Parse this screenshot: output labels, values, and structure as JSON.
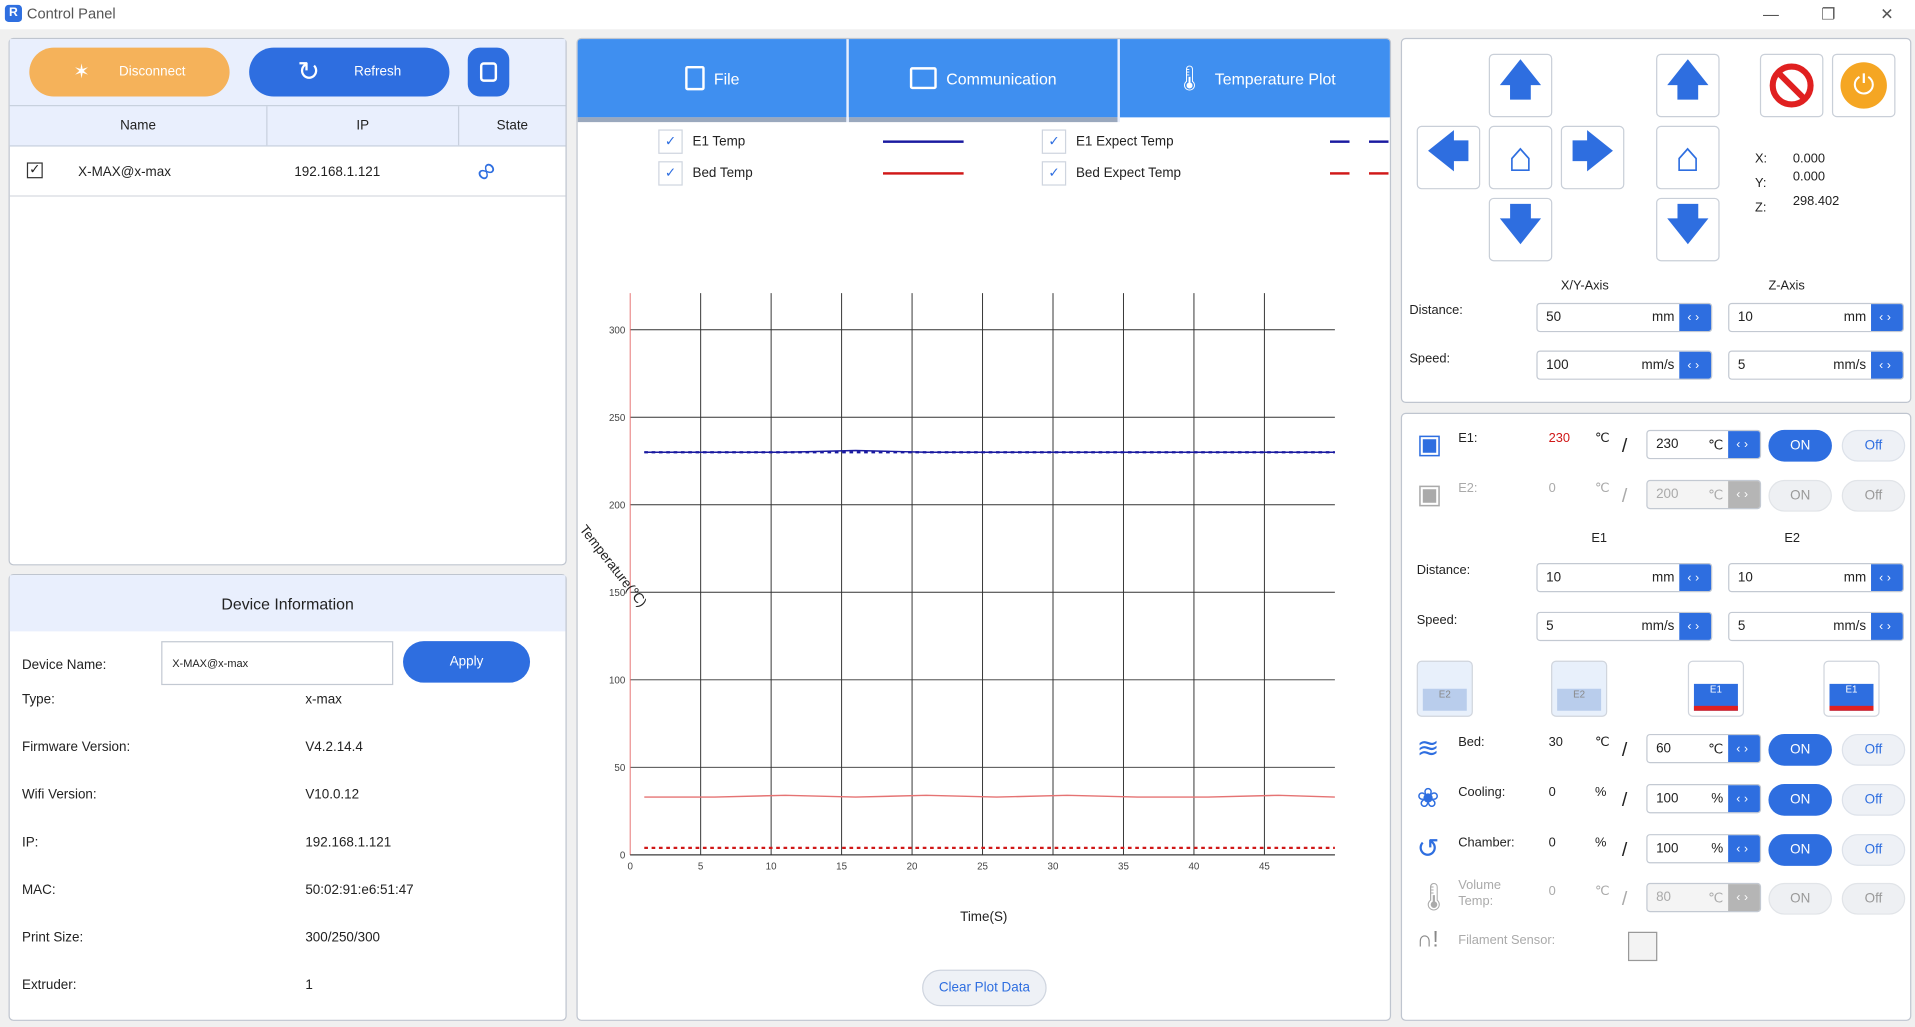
{
  "window": {
    "title": "Control Panel",
    "app_icon": "app-logo-icon"
  },
  "connection": {
    "disconnect_label": "Disconnect",
    "refresh_label": "Refresh",
    "columns": [
      "Name",
      "IP",
      "State"
    ],
    "rows": [
      {
        "checked": true,
        "name": "X-MAX@x-max",
        "ip": "192.168.1.121",
        "state_icon": "link-icon"
      }
    ]
  },
  "device_info": {
    "title": "Device Information",
    "name_label": "Device Name:",
    "name_value": "X-MAX@x-max",
    "apply_label": "Apply",
    "fields": [
      {
        "label": "Type:",
        "value": "x-max"
      },
      {
        "label": "Firmware Version:",
        "value": "V4.2.14.4"
      },
      {
        "label": "Wifi Version:",
        "value": "V10.0.12"
      },
      {
        "label": "IP:",
        "value": "192.168.1.121"
      },
      {
        "label": "MAC:",
        "value": "50:02:91:e6:51:47"
      },
      {
        "label": "Print Size:",
        "value": "300/250/300"
      },
      {
        "label": "Extruder:",
        "value": "1"
      }
    ]
  },
  "tabs": [
    {
      "label": "File",
      "icon": "file-icon"
    },
    {
      "label": "Communication",
      "icon": "communication-icon"
    },
    {
      "label": "Temperature Plot",
      "icon": "thermometer-icon"
    }
  ],
  "legend": [
    {
      "label": "E1 Temp",
      "color": "#1a1aa0",
      "dashed": false
    },
    {
      "label": "E1 Expect Temp",
      "color": "#1a1aa0",
      "dashed": true
    },
    {
      "label": "Bed Temp",
      "color": "#d01818",
      "dashed": false
    },
    {
      "label": "Bed Expect Temp",
      "color": "#d01818",
      "dashed": true
    }
  ],
  "chart_data": {
    "type": "line",
    "ylabel": "Temperature(℃)",
    "xlabel": "Time(S)",
    "xlim": [
      0,
      50
    ],
    "ylim": [
      0,
      300
    ],
    "xticks": [
      0,
      5,
      10,
      15,
      20,
      25,
      30,
      35,
      40,
      45
    ],
    "yticks": [
      0,
      50,
      100,
      150,
      200,
      250,
      300
    ],
    "x": [
      0,
      5,
      10,
      15,
      20,
      25,
      30,
      35,
      40,
      45,
      49
    ],
    "series": [
      {
        "name": "E1 Temp",
        "color": "#1a1aa0",
        "values": [
          230,
          230,
          230,
          231,
          230,
          230,
          230,
          230,
          230,
          230,
          230
        ]
      },
      {
        "name": "E1 Expect Temp",
        "color": "#1a1aa0",
        "dashed": true,
        "values": [
          230,
          230,
          230,
          230,
          230,
          230,
          230,
          230,
          230,
          230,
          230
        ]
      },
      {
        "name": "Bed Temp",
        "color": "#e57373",
        "values": [
          33,
          33,
          34,
          33,
          34,
          33,
          34,
          33,
          33,
          34,
          33
        ]
      },
      {
        "name": "Bed Expect Temp",
        "color": "#d01818",
        "dashed": true,
        "values": [
          4,
          4,
          4,
          4,
          4,
          4,
          4,
          4,
          4,
          4,
          4
        ]
      }
    ]
  },
  "clear_label": "Clear Plot Data",
  "motion": {
    "x_label": "X:",
    "x_value": "0.000",
    "y_label": "Y:",
    "y_value": "0.000",
    "z_label": "Z:",
    "z_value": "298.402",
    "xy_axis_label": "X/Y-Axis",
    "z_axis_label": "Z-Axis",
    "distance_label": "Distance:",
    "speed_label": "Speed:",
    "xy_distance": "50",
    "xy_distance_unit": "mm",
    "xy_speed": "100",
    "xy_speed_unit": "mm/s",
    "z_distance": "10",
    "z_distance_unit": "mm",
    "z_speed": "5",
    "z_speed_unit": "mm/s"
  },
  "temps": {
    "e1": {
      "label": "E1:",
      "current": "230",
      "unit": "℃",
      "slash": "/",
      "target": "230",
      "on": "ON",
      "off": "Off"
    },
    "e2": {
      "label": "E2:",
      "current": "0",
      "unit": "℃",
      "slash": "/",
      "target": "200",
      "on": "ON",
      "off": "Off"
    },
    "e1_col": "E1",
    "e2_col": "E2",
    "distance_label": "Distance:",
    "speed_label": "Speed:",
    "e1_distance": "10",
    "e2_distance": "10",
    "dist_unit": "mm",
    "e1_speed": "5",
    "e2_speed": "5",
    "speed_unit": "mm/s",
    "bed": {
      "label": "Bed:",
      "current": "30",
      "unit": "℃",
      "slash": "/",
      "target": "60",
      "on": "ON",
      "off": "Off"
    },
    "cooling": {
      "label": "Cooling:",
      "current": "0",
      "unit": "%",
      "slash": "/",
      "target": "100",
      "on": "ON",
      "off": "Off"
    },
    "chamber": {
      "label": "Chamber:",
      "current": "0",
      "unit": "%",
      "slash": "/",
      "target": "100",
      "on": "ON",
      "off": "Off"
    },
    "volume": {
      "label": "Volume Temp:",
      "current": "0",
      "unit": "℃",
      "slash": "/",
      "target": "80",
      "on": "ON",
      "off": "Off"
    },
    "filament_label": "Filament Sensor:"
  },
  "extruder_buttons": {
    "e2_label": "E2",
    "e1_label": "E1"
  },
  "colors": {
    "accent": "#2e6ee0",
    "disconnect": "#f5b25a",
    "tab": "#3f8ff0",
    "stop": "#e02020",
    "power": "#f5a623"
  }
}
